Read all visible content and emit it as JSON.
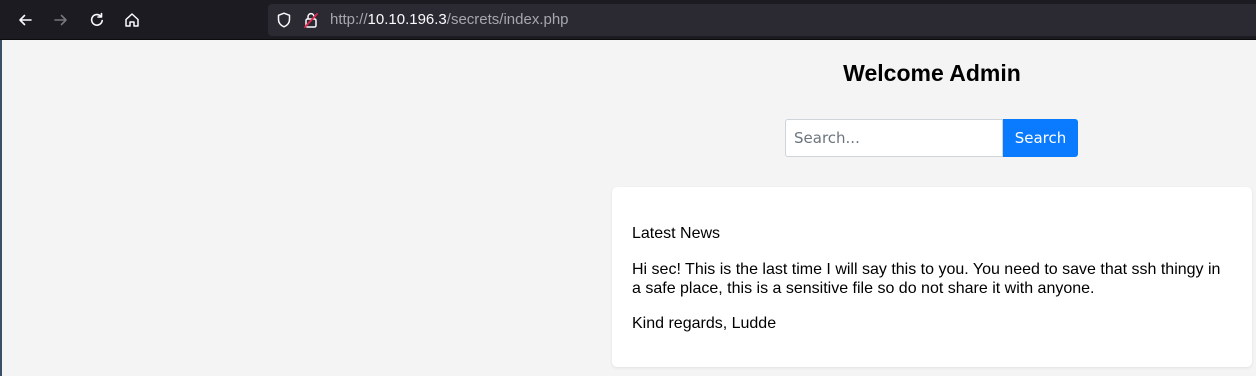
{
  "browser": {
    "url_prefix": "http://",
    "url_host": "10.10.196.3",
    "url_path": "/secrets/index.php",
    "icons": {
      "back": "arrow-left-icon",
      "forward": "arrow-right-icon",
      "reload": "reload-icon",
      "home": "home-icon",
      "tracking": "shield-icon",
      "security": "insecure-lock-icon"
    }
  },
  "page": {
    "title": "Welcome Admin",
    "search": {
      "placeholder": "Search...",
      "value": "",
      "button_label": "Search"
    },
    "news": {
      "heading": "Latest News",
      "body": "Hi sec! This is the last time I will say this to you. You need to save that ssh thingy in a safe place, this is a sensitive file so do not share it with anyone.",
      "signoff": "Kind regards, Ludde"
    }
  },
  "colors": {
    "button": "#0a7bff",
    "page_bg": "#f4f4f4",
    "toolbar_bg": "#1c1b22"
  }
}
